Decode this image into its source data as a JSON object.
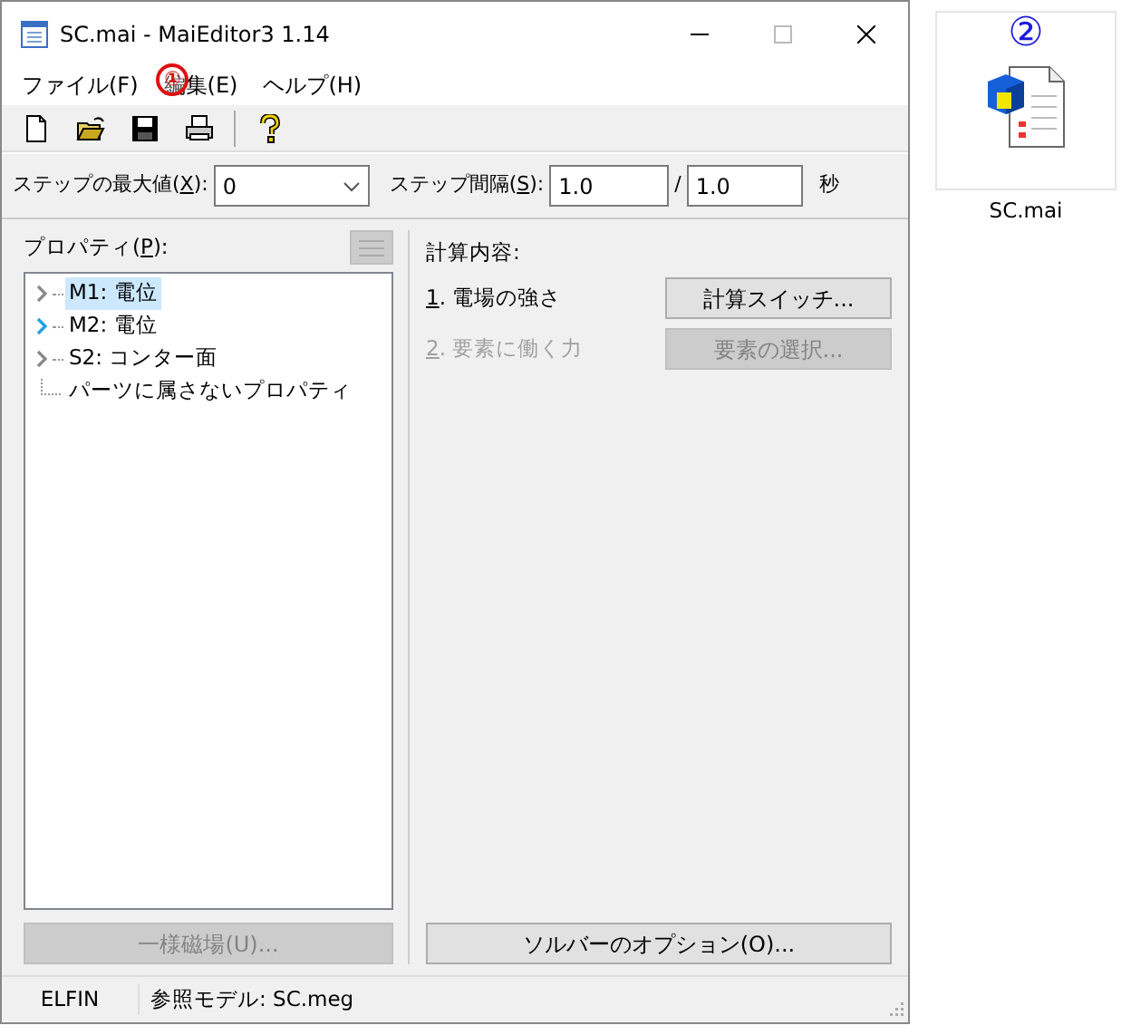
{
  "window": {
    "title": "SC.mai - MaiEditor3 1.14"
  },
  "menu": [
    {
      "label": "ファイル(F)"
    },
    {
      "label": "編集(E)",
      "annotation": "①"
    },
    {
      "label": "ヘルプ(H)"
    }
  ],
  "toolbar": [
    {
      "kind": "new"
    },
    {
      "kind": "open"
    },
    {
      "kind": "save"
    },
    {
      "kind": "print"
    },
    {
      "kind": "separator"
    },
    {
      "kind": "help"
    }
  ],
  "params": {
    "max_step": {
      "label": [
        "ステップの最大値(",
        "X",
        "):"
      ],
      "value": "0"
    },
    "interval": {
      "label": [
        "ステップ間隔(",
        "S",
        "):"
      ],
      "value": "1.0",
      "slash": "/",
      "value2": "1.0",
      "unit": "秒"
    }
  },
  "properties": {
    "label": [
      "プロパティ(",
      "P",
      "):"
    ],
    "items": [
      {
        "label": "M1: 電位",
        "kind": "node",
        "selected": true,
        "hot": false
      },
      {
        "label": "M2: 電位",
        "kind": "node",
        "selected": false,
        "hot": true
      },
      {
        "label": "S2: コンター面",
        "kind": "node",
        "selected": false,
        "hot": false
      },
      {
        "label": "パーツに属さないプロパティ",
        "kind": "leaf",
        "selected": false
      }
    ],
    "button": {
      "label": "一様磁場(U)...",
      "disabled": true
    }
  },
  "calc": {
    "label": "計算内容:",
    "rows": [
      {
        "num": "1",
        "text": ". 電場の強さ",
        "disabled": false,
        "button": "計算スイッチ..."
      },
      {
        "num": "2",
        "text": ". 要素に働く力",
        "disabled": true,
        "button": "要素の選択..."
      }
    ],
    "solver_button": "ソルバーのオプション(O)..."
  },
  "status_bar": [
    "ELFIN",
    "参照モデル: SC.meg"
  ],
  "desktop_icon": {
    "label": "SC.mai",
    "annotation": "②"
  }
}
